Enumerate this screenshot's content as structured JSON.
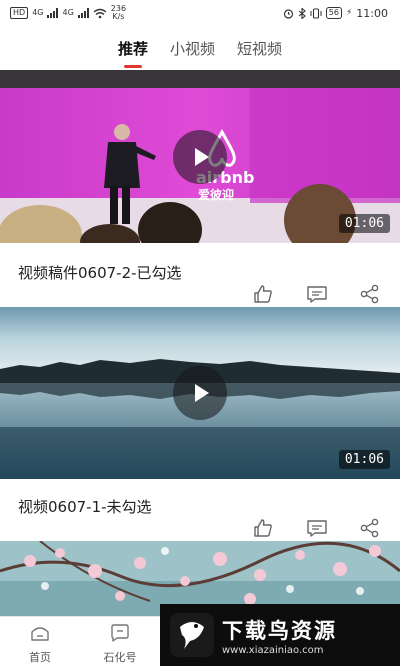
{
  "status_bar": {
    "left_tag": "HD",
    "net_type": "4G",
    "net_type2": "4G",
    "speed": "236",
    "speed_unit": "K/s",
    "battery": "56",
    "time": "11:00"
  },
  "tabs": [
    {
      "label": "推荐",
      "active": true
    },
    {
      "label": "小视频",
      "active": false
    },
    {
      "label": "短视频",
      "active": false
    }
  ],
  "videos": [
    {
      "title": "视频稿件0607-2-已勾选",
      "duration": "01:06",
      "brand_text": "airbnb",
      "brand_sub": "爱彼迎"
    },
    {
      "title": "视频0607-1-未勾选",
      "duration": "01:06"
    },
    {
      "title": "",
      "duration": ""
    }
  ],
  "bottom_nav": [
    {
      "label": "首页"
    },
    {
      "label": "石化号"
    }
  ],
  "watermark": {
    "title": "下载鸟资源",
    "url": "www.xiazainiao.com"
  },
  "colors": {
    "accent": "#e2382b",
    "stage": "#d63fd0"
  }
}
